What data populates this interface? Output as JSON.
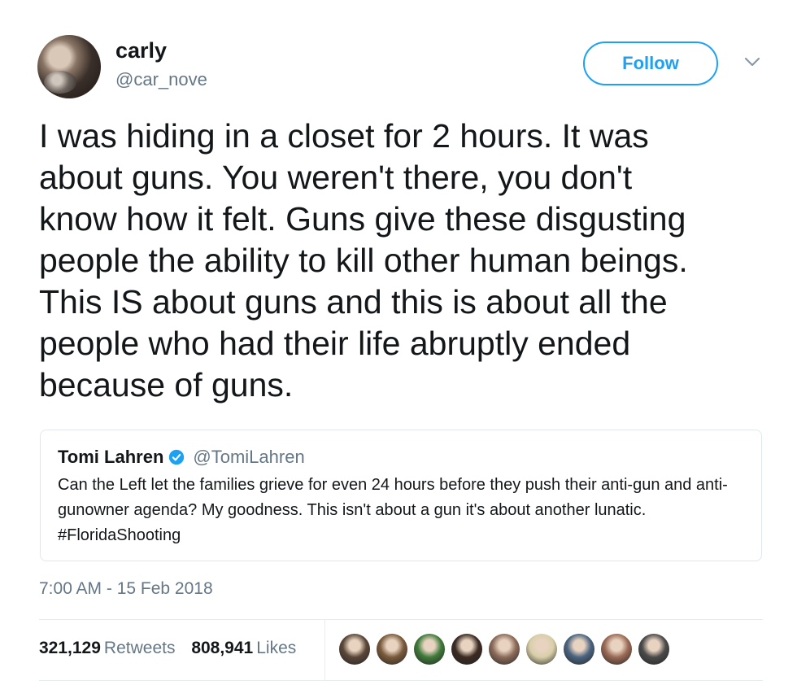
{
  "author": {
    "display_name": "carly",
    "handle": "@car_nove"
  },
  "follow_label": "Follow",
  "tweet_text": "I was hiding in a closet for 2 hours. It was\nabout guns. You weren't there, you don't\nknow how it felt. Guns give these disgusting\npeople the ability to kill other human beings.\nThis IS about guns and this is about all the\npeople who had their life abruptly ended\nbecause of guns.",
  "quoted_tweet": {
    "display_name": "Tomi Lahren",
    "handle": "@TomiLahren",
    "text": "Can the Left let the families grieve for even 24 hours before they push their anti-gun and anti-gunowner agenda? My goodness. This isn't about a gun it's about another lunatic. #FloridaShooting"
  },
  "timestamp": "7:00 AM - 15 Feb 2018",
  "stats": {
    "retweets_count": "321,129",
    "retweets_label": "Retweets",
    "likes_count": "808,941",
    "likes_label": "Likes"
  },
  "colors": {
    "accent": "#1da1f2",
    "secondary_text": "#657786",
    "primary_text": "#14171a"
  },
  "liker_avatar_colors": [
    "#5a4638",
    "#7a5a3c",
    "#3f7a3a",
    "#3b2a22",
    "#8c6b5a",
    "#d8cfa8",
    "#4b6480",
    "#9a6a56",
    "#4a4a4a"
  ]
}
